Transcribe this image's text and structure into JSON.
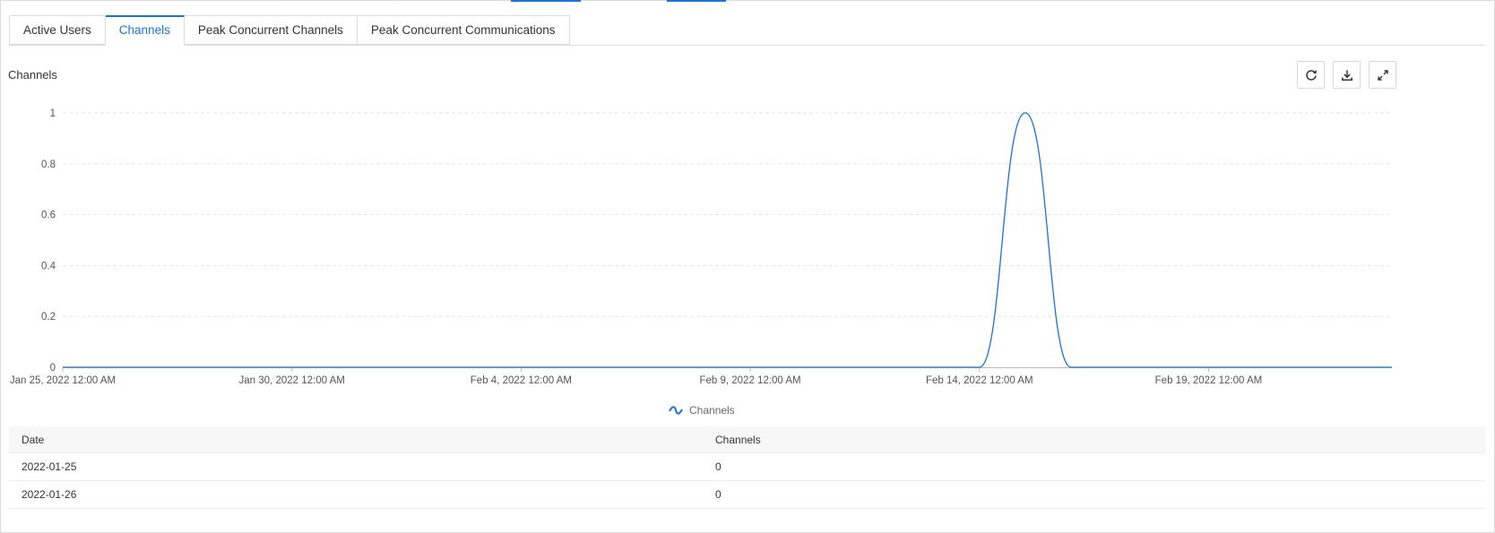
{
  "tabs": [
    {
      "label": "Active Users",
      "active": false
    },
    {
      "label": "Channels",
      "active": true
    },
    {
      "label": "Peak Concurrent Channels",
      "active": false
    },
    {
      "label": "Peak Concurrent Communications",
      "active": false
    }
  ],
  "panel": {
    "title": "Channels",
    "tools": [
      "refresh-icon",
      "download-icon",
      "expand-icon"
    ]
  },
  "colors": {
    "accent": "#1a73d9",
    "series": "#1a73d9",
    "grid": "#e6e6e6"
  },
  "chart_data": {
    "type": "line",
    "title": "",
    "xlabel": "",
    "ylabel": "",
    "x_ticks": [
      {
        "label": "Jan 25, 2022 12:00 AM",
        "date": "2022-01-25"
      },
      {
        "label": "Jan 30, 2022 12:00 AM",
        "date": "2022-01-30"
      },
      {
        "label": "Feb 4, 2022 12:00 AM",
        "date": "2022-02-04"
      },
      {
        "label": "Feb 9, 2022 12:00 AM",
        "date": "2022-02-09"
      },
      {
        "label": "Feb 14, 2022 12:00 AM",
        "date": "2022-02-14"
      },
      {
        "label": "Feb 19, 2022 12:00 AM",
        "date": "2022-02-19"
      }
    ],
    "y_ticks": [
      "0",
      "0.2",
      "0.4",
      "0.6",
      "0.8",
      "1"
    ],
    "ylim": [
      0,
      1
    ],
    "xlim": [
      "2022-01-25",
      "2022-02-23"
    ],
    "grid": true,
    "legend_position": "bottom-center",
    "smooth": true,
    "series": [
      {
        "name": "Channels",
        "x": [
          "2022-01-25",
          "2022-01-26",
          "2022-01-27",
          "2022-01-28",
          "2022-01-29",
          "2022-01-30",
          "2022-01-31",
          "2022-02-01",
          "2022-02-02",
          "2022-02-03",
          "2022-02-04",
          "2022-02-05",
          "2022-02-06",
          "2022-02-07",
          "2022-02-08",
          "2022-02-09",
          "2022-02-10",
          "2022-02-11",
          "2022-02-12",
          "2022-02-13",
          "2022-02-14",
          "2022-02-15",
          "2022-02-16",
          "2022-02-17",
          "2022-02-18",
          "2022-02-19",
          "2022-02-20",
          "2022-02-21",
          "2022-02-22",
          "2022-02-23"
        ],
        "values": [
          0,
          0,
          0,
          0,
          0,
          0,
          0,
          0,
          0,
          0,
          0,
          0,
          0,
          0,
          0,
          0,
          0,
          0,
          0,
          0,
          0,
          1,
          0,
          0,
          0,
          0,
          0,
          0,
          0,
          0
        ]
      }
    ]
  },
  "table": {
    "columns": [
      "Date",
      "Channels"
    ],
    "rows": [
      [
        "2022-01-25",
        "0"
      ],
      [
        "2022-01-26",
        "0"
      ]
    ]
  }
}
